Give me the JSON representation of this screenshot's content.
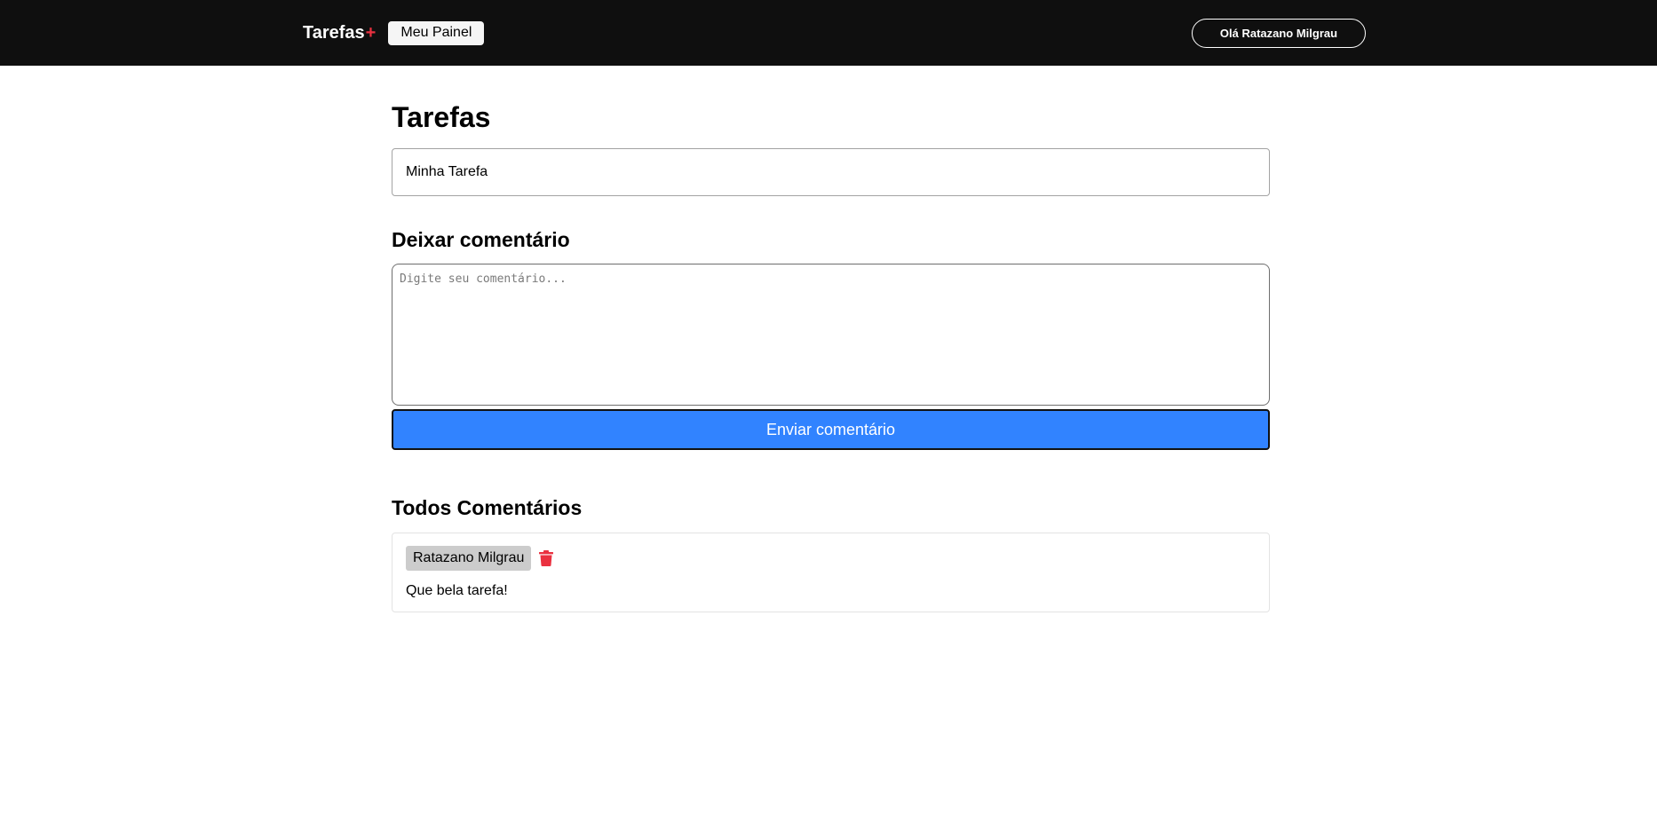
{
  "header": {
    "brand": "Tarefas",
    "brand_plus": "+",
    "panel_button": "Meu Painel",
    "user_button": "Olá Ratazano Milgrau"
  },
  "main": {
    "title": "Tarefas",
    "task_text": "Minha Tarefa",
    "comment_section_title": "Deixar comentário",
    "comment_placeholder": "Digite seu comentário...",
    "comment_value": "",
    "send_button": "Enviar comentário",
    "all_comments_title": "Todos Comentários",
    "comments": [
      {
        "author": "Ratazano Milgrau",
        "text": "Que bela tarefa!",
        "delete_icon": "trash-icon"
      }
    ]
  },
  "colors": {
    "header_bg": "#0f0f0f",
    "accent_red": "#ea3140",
    "button_blue": "#3183ff",
    "author_tag_bg": "#cccccc"
  }
}
